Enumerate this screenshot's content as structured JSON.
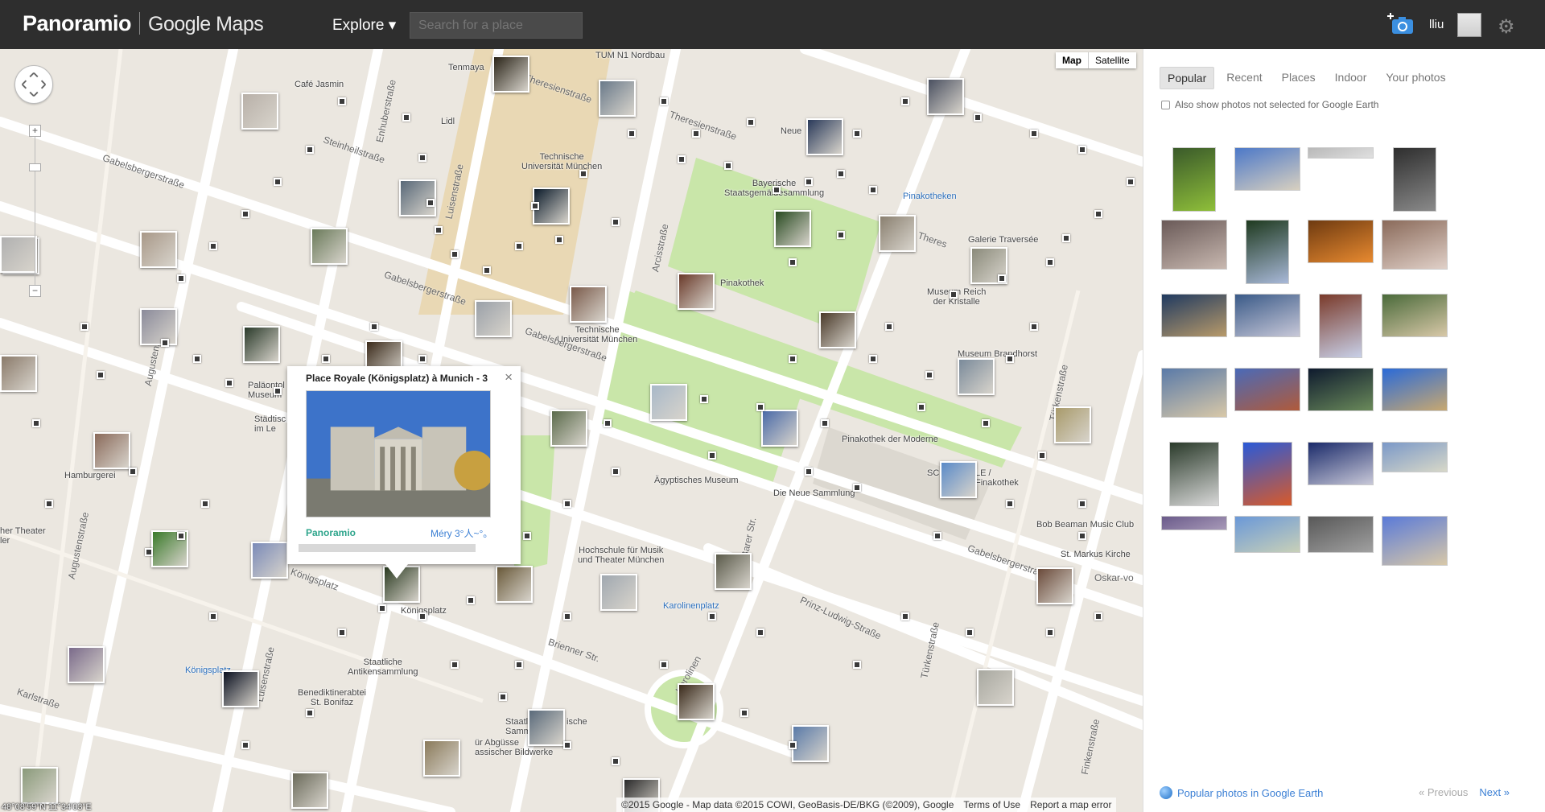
{
  "header": {
    "brand": "Panoramio",
    "product": "Google Maps",
    "explore_label": "Explore ▾",
    "search_placeholder": "Search for a place",
    "username": "lliu"
  },
  "map": {
    "type_buttons": {
      "map": "Map",
      "satellite": "Satellite"
    },
    "zoom_in": "+",
    "zoom_out": "−",
    "coords": "48°08'59\"N 11°34'03\"E",
    "attribution": {
      "data": "©2015 Google - Map data ©2015 COWI, GeoBasis-DE/BKG (©2009), Google",
      "terms": "Terms of Use",
      "report": "Report a map error"
    },
    "places": [
      {
        "name": "Tenmaya",
        "color": "#444"
      },
      {
        "name": "TUM N1 Nordbau",
        "color": "#444"
      },
      {
        "name": "Café Jasmin",
        "color": "#444"
      },
      {
        "name": "Lidl",
        "color": "#444"
      },
      {
        "name": "Technische\nUniversität München",
        "color": "#444"
      },
      {
        "name": "Neue",
        "color": "#444"
      },
      {
        "name": "Bayerische\nStaatsgemäldesammlung",
        "color": "#444"
      },
      {
        "name": "Pinakotheken",
        "color": "#2a6ebb"
      },
      {
        "name": "Galerie Traversée",
        "color": "#444"
      },
      {
        "name": "Pinakothek",
        "color": "#444"
      },
      {
        "name": "Museum Reich\nder Kristalle",
        "color": "#444"
      },
      {
        "name": "Technische\nUniversität München",
        "color": "#444"
      },
      {
        "name": "Museum Brandhorst",
        "color": "#444"
      },
      {
        "name": "Pinakothek der Moderne",
        "color": "#444"
      },
      {
        "name": "Ägyptisches Museum",
        "color": "#444"
      },
      {
        "name": "Die Neue Sammlung",
        "color": "#444"
      },
      {
        "name": "Bob Beaman Music Club",
        "color": "#444"
      },
      {
        "name": "St. Markus Kirche",
        "color": "#444"
      },
      {
        "name": "Hochschule für Musik\nund Theater München",
        "color": "#444"
      },
      {
        "name": "Karolinenplatz",
        "color": "#2a6ebb"
      },
      {
        "name": "Hamburgerei",
        "color": "#444"
      },
      {
        "name": "Königsplatz",
        "color": "#444"
      },
      {
        "name": "Königsplatz",
        "color": "#2a6ebb"
      },
      {
        "name": "Staatliche\nAntikensammlung",
        "color": "#444"
      },
      {
        "name": "Benediktinerabtei\nSt. Bonifaz",
        "color": "#444"
      },
      {
        "name": "her Theater\nler",
        "color": "#444"
      },
      {
        "name": "Staatl\nSamm",
        "color": "#444"
      },
      {
        "name": "ische",
        "color": "#444"
      },
      {
        "name": "ür Abgüsse\nassischer Bildwerke",
        "color": "#444"
      },
      {
        "name": "SC",
        "color": "#444"
      },
      {
        "name": "LE /\nFinakothek",
        "color": "#444"
      },
      {
        "name": "Paläontol\nMuseum",
        "color": "#444"
      },
      {
        "name": "Städtisc\nim Le",
        "color": "#444"
      }
    ],
    "streets": [
      "Theresienstraße",
      "Theresienstraße",
      "Gabelsbergerstraße",
      "Gabelsbergerstraße",
      "Gabelsbergerstraße",
      "Steinheilstraße",
      "Enhuberstraße",
      "Luisenstraße",
      "Arcisstraße",
      "Augustenstraße",
      "Augustenstraße",
      "Karlstraße",
      "Brienner Str.",
      "Prinz-Ludwig-Straße",
      "Türkenstraße",
      "Türkenstraße",
      "Finkenstraße",
      "Oskar-vo",
      "Karolinen",
      "Königsplatz",
      "Theres",
      "Gabelsbergerstraße",
      "Luisenstraße",
      "Barer Str."
    ],
    "popup": {
      "title": "Place Royale (Königsplatz) à Munich - 3",
      "close": "×",
      "logo": "Panoramio",
      "author": "Méry 3°人~°。"
    }
  },
  "panel": {
    "tabs": [
      "Popular",
      "Recent",
      "Places",
      "Indoor",
      "Your photos"
    ],
    "also_show": "Also show photos not selected for Google Earth",
    "photos": [
      {
        "c1": "#3a5a2a",
        "c2": "#8fbf3a"
      },
      {
        "c1": "#4c78c8",
        "c2": "#d8d0c0"
      },
      {
        "c1": "#b8b8b8",
        "c2": "#e0e0e0"
      },
      {
        "c1": "#2e2e2e",
        "c2": "#8a8a8a"
      },
      {
        "c1": "#6a5a58",
        "c2": "#c8b8b0"
      },
      {
        "c1": "#1f3a1f",
        "c2": "#a8b8d8"
      },
      {
        "c1": "#6e3a10",
        "c2": "#e88a30"
      },
      {
        "c1": "#8a6a5a",
        "c2": "#e0d0c8"
      },
      {
        "c1": "#203a60",
        "c2": "#b89a6a"
      },
      {
        "c1": "#3a5a88",
        "c2": "#c8c8d8"
      },
      {
        "c1": "#7a3a2a",
        "c2": "#c8d0e8"
      },
      {
        "c1": "#4a6a3a",
        "c2": "#d8c8a8"
      },
      {
        "c1": "#5a7aa8",
        "c2": "#d8c8a8"
      },
      {
        "c1": "#4a6ab8",
        "c2": "#b05a3a"
      },
      {
        "c1": "#0e1a2e",
        "c2": "#6a8a5a"
      },
      {
        "c1": "#2a6ad8",
        "c2": "#c8a870"
      },
      {
        "c1": "#2a3a2a",
        "c2": "#d8d8d8"
      },
      {
        "c1": "#2a5ad8",
        "c2": "#d85a2a"
      },
      {
        "c1": "#1a2a6a",
        "c2": "#c8c8d8"
      },
      {
        "c1": "#7a98c8",
        "c2": "#d8d8c8"
      },
      {
        "c1": "#6a5a8a",
        "c2": "#a89ab8"
      },
      {
        "c1": "#6a98d8",
        "c2": "#c8d0b8"
      },
      {
        "c1": "#585858",
        "c2": "#a0a0a0"
      },
      {
        "c1": "#5a7ad8",
        "c2": "#d8c8a8"
      }
    ],
    "ge_link": "Popular photos in Google Earth",
    "prev": "« Previous",
    "next": "Next »"
  },
  "colors": {
    "header_bg": "#2e2e2e",
    "map_bg": "#ebe7e0",
    "park": "#c9e6a9",
    "campus": "#e9d8b4",
    "link_blue": "#3b7fd4",
    "panoramio_green": "#2ea58c"
  },
  "icons": [
    "pan-control-icon",
    "camera-upload-icon",
    "gear-icon",
    "google-earth-icon",
    "close-icon",
    "checkbox-icon"
  ]
}
